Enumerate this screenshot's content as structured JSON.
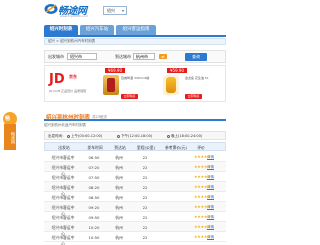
{
  "header": {
    "logo_text": "畅途网",
    "logo_url": "www.trip8080.com",
    "city_selector": "绍兴",
    "brand_color": "#1a6fc4"
  },
  "nav": {
    "tabs": [
      {
        "label": "绍兴时刻表",
        "active": true
      },
      {
        "label": "绍兴汽车站",
        "active": false
      },
      {
        "label": "绍兴客运指南",
        "active": false
      }
    ]
  },
  "breadcrumb": "绍兴 > 绍兴到杭州汽车时刻表",
  "search": {
    "from_label": "出发城市",
    "from_value": "绍兴市",
    "to_label": "到达城市",
    "to_value": "杭州市",
    "swap_icon": "swap-icon",
    "button_label": "查询"
  },
  "ad": {
    "brand_big": "JD",
    "brand_name": "京东",
    "brand_sub": "JD.COM 正品低价 品质保障",
    "products": [
      {
        "price": "¥69.90",
        "desc": "百威啤酒 330ml 6罐",
        "buy": "立即购买"
      },
      {
        "price": "¥59.90",
        "desc": "金龙鱼 花生油 5L",
        "buy": "立即购买"
      }
    ]
  },
  "side_badge": {
    "circle": "畅",
    "body": "畅途网"
  },
  "schedule": {
    "title": "绍兴到杭州时刻表",
    "note": "共23班次",
    "subtitle": "绍兴到杭州长途汽车时刻表",
    "filter_label": "出发时间：",
    "filter_options": [
      "上午(00:00-12:00)",
      "下午(12:00-18:00)",
      "晚上(18:00-24:00)"
    ],
    "columns": [
      "出发站",
      "发车时间",
      "到达站",
      "里程(公里)",
      "参考票价(元)",
      "评价",
      ""
    ],
    "rows": [
      {
        "station": "绍兴市客运中心",
        "time": "06:50",
        "dest": "杭州",
        "km": "22",
        "price": "",
        "stars": "★★★★★",
        "link": "详情"
      },
      {
        "station": "绍兴市客运中心",
        "time": "07:20",
        "dest": "杭州",
        "km": "22",
        "price": "",
        "stars": "★★★★★",
        "link": "详情"
      },
      {
        "station": "绍兴市客运中心",
        "time": "07:50",
        "dest": "杭州",
        "km": "22",
        "price": "",
        "stars": "★★★★★",
        "link": "详情"
      },
      {
        "station": "绍兴市客运中心",
        "time": "08:20",
        "dest": "杭州",
        "km": "22",
        "price": "",
        "stars": "★★★★★",
        "link": "详情"
      },
      {
        "station": "绍兴市客运中心",
        "time": "08:50",
        "dest": "杭州",
        "km": "22",
        "price": "",
        "stars": "★★★★★",
        "link": "详情"
      },
      {
        "station": "绍兴市客运中心",
        "time": "09:20",
        "dest": "杭州",
        "km": "22",
        "price": "",
        "stars": "★★★★★",
        "link": "详情"
      },
      {
        "station": "绍兴市客运中心",
        "time": "09:50",
        "dest": "杭州",
        "km": "22",
        "price": "",
        "stars": "★★★★★",
        "link": "详情"
      },
      {
        "station": "绍兴市客运中心",
        "time": "10:20",
        "dest": "杭州",
        "km": "22",
        "price": "",
        "stars": "★★★★★",
        "link": "详情"
      },
      {
        "station": "绍兴市客运中心",
        "time": "10:50",
        "dest": "杭州",
        "km": "22",
        "price": "",
        "stars": "★★★★★",
        "link": "详情"
      }
    ]
  }
}
